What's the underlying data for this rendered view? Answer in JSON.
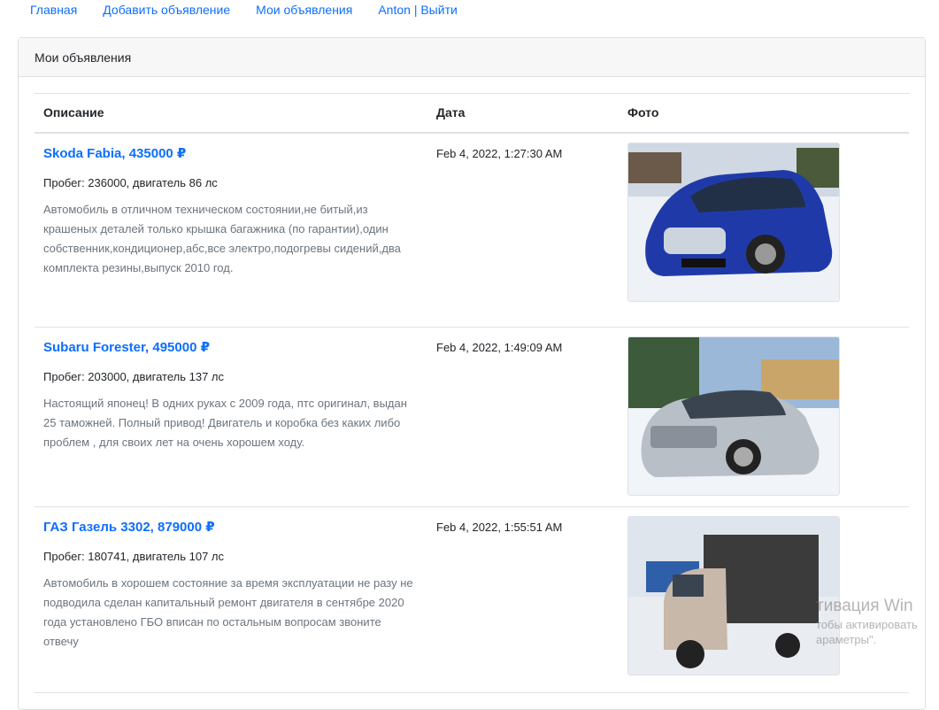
{
  "nav": {
    "home": "Главная",
    "add": "Добавить объявление",
    "my": "Мои объявления",
    "user": "Anton | Выйти"
  },
  "card": {
    "title": "Мои объявления"
  },
  "table": {
    "headers": {
      "description": "Описание",
      "date": "Дата",
      "photo": "Фото"
    },
    "rows": [
      {
        "title": "Skoda Fabia, 435000 ₽",
        "mileage": "Пробег: 236000, двигатель 86 лс",
        "text": "Автомобиль в отличном техническом состоянии,не битый,из крашеных деталей только крышка багажника (по гарантии),один собственник,кондиционер,абс,все электро,подогревы сидений,два комплекта резины,выпуск 2010 год.",
        "date": "Feb 4, 2022, 1:27:30 AM",
        "color": "#1f3aa8"
      },
      {
        "title": "Subaru Forester, 495000 ₽",
        "mileage": "Пробег: 203000, двигатель 137 лс",
        "text": "Настоящий японец! В одних руках с 2009 года, птс оригинал, выдан 25 таможней. Полный привод! Двигатель и коробка без каких либо проблем , для своих лет на очень хорошем ходу.",
        "date": "Feb 4, 2022, 1:49:09 AM",
        "color": "#b9bfc6"
      },
      {
        "title": "ГАЗ Газель 3302, 879000 ₽",
        "mileage": "Пробег: 180741, двигатель 107 лс",
        "text": "Автомобиль в хорошем состояние за время эксплуатации не разу не подводила сделан капитальный ремонт двигателя в сентябре 2020 года установлено ГБО вписан по остальным вопросам звоните отвечу",
        "date": "Feb 4, 2022, 1:55:51 AM",
        "color": "#c8b8aa"
      }
    ]
  },
  "watermark": {
    "line1": "тивация Win",
    "line2": "тобы активировать",
    "line3": "араметры\"."
  }
}
